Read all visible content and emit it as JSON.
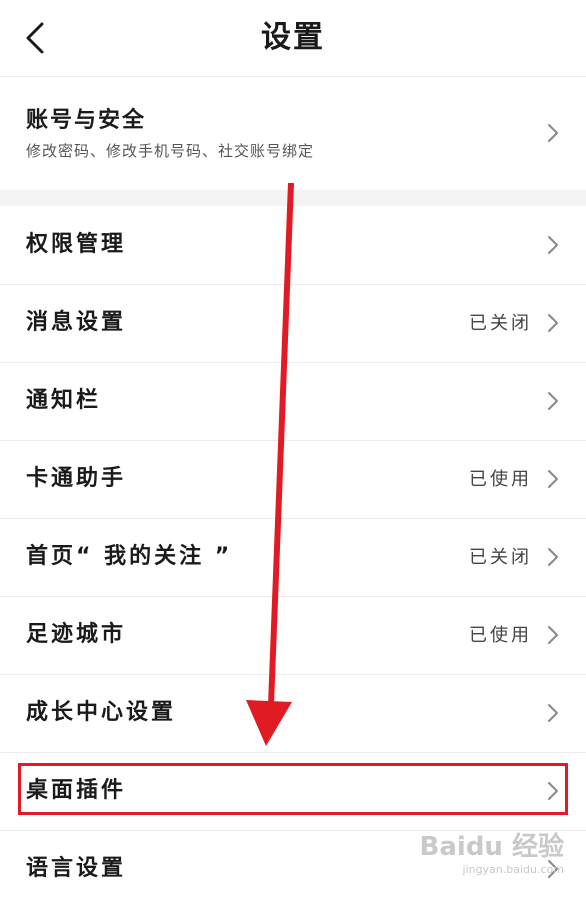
{
  "header": {
    "title": "设置",
    "back_icon": "chevron-left-icon"
  },
  "account": {
    "title": "账号与安全",
    "subtitle": "修改密码、修改手机号码、社交账号绑定"
  },
  "rows": [
    {
      "label": "权限管理",
      "status": ""
    },
    {
      "label": "消息设置",
      "status": "已关闭"
    },
    {
      "label": "通知栏",
      "status": ""
    },
    {
      "label": "卡通助手",
      "status": "已使用"
    },
    {
      "label": "首页“ 我的关注 ”",
      "status": "已关闭"
    },
    {
      "label": "足迹城市",
      "status": "已使用"
    },
    {
      "label": "成长中心设置",
      "status": ""
    },
    {
      "label": "桌面插件",
      "status": ""
    },
    {
      "label": "语言设置",
      "status": ""
    }
  ],
  "colors": {
    "annotation_red": "#e01b24",
    "divider": "#ececec",
    "section_gap": "#f4f4f4"
  },
  "watermark": {
    "logo": "Baidu 经验",
    "url": "jingyan.baidu.com"
  }
}
